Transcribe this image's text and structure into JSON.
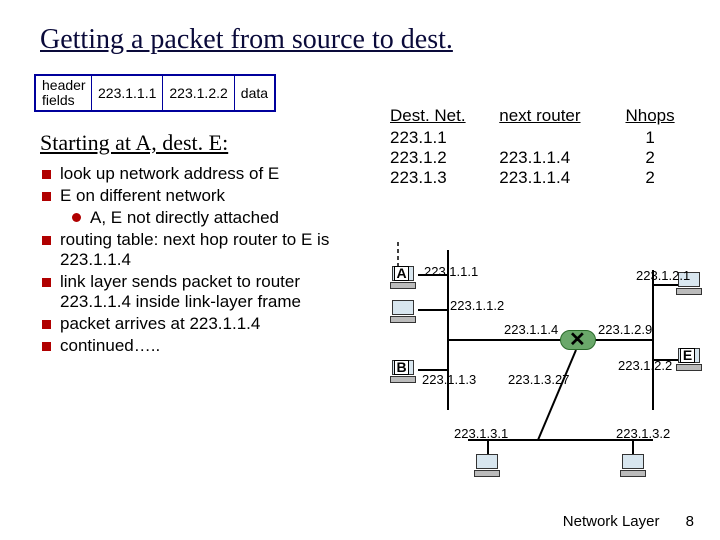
{
  "title": "Getting a packet from source to dest.",
  "packet": {
    "hdr1": "header",
    "hdr2": "fields",
    "src": "223.1.1.1",
    "dst": "223.1.2.2",
    "data": "data"
  },
  "subhead": "Starting at A, dest. E:",
  "bullets": {
    "b0": "look up network address of E",
    "b1": "E on different network",
    "b1a": "A, E not directly attached",
    "b2": "routing table: next hop router to E is 223.1.1.4",
    "b3": "link layer sends packet to router 223.1.1.4 inside link-layer frame",
    "b4": "packet arrives at 223.1.1.4",
    "b5": "continued….."
  },
  "routing": {
    "h0": "Dest. Net.",
    "h1": "next router",
    "h2": "Nhops",
    "rows": [
      {
        "net": "223.1.1",
        "router": "",
        "hops": "1"
      },
      {
        "net": "223.1.2",
        "router": "223.1.1.4",
        "hops": "2"
      },
      {
        "net": "223.1.3",
        "router": "223.1.1.4",
        "hops": "2"
      }
    ]
  },
  "labels": {
    "a": "A",
    "b": "B",
    "e": "E",
    "ip_111": "223.1.1.1",
    "ip_112": "223.1.1.2",
    "ip_113": "223.1.1.3",
    "ip_114": "223.1.1.4",
    "ip_121": "223.1.2.1",
    "ip_122": "223.1.2.2",
    "ip_129": "223.1.2.9",
    "ip_1327": "223.1.3.27",
    "ip_131": "223.1.3.1",
    "ip_132": "223.1.3.2"
  },
  "footer": {
    "section": "Network Layer",
    "page": "8"
  }
}
